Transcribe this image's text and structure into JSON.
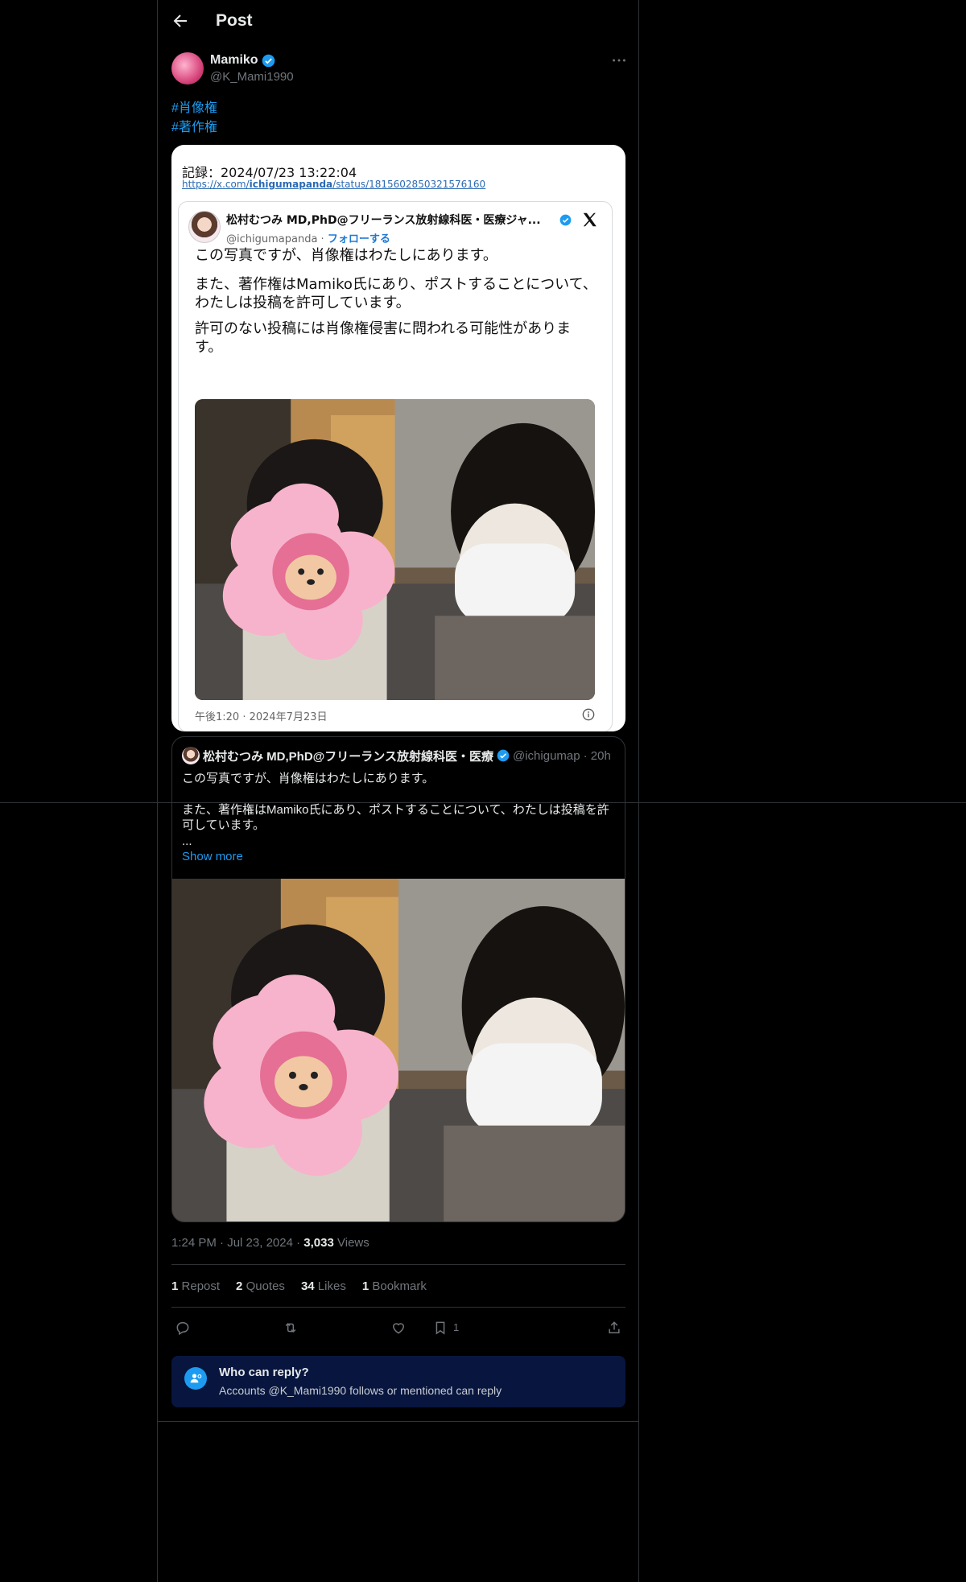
{
  "header": {
    "title": "Post"
  },
  "author": {
    "name": "Mamiko",
    "handle": "@K_Mami1990"
  },
  "hashtags": [
    "#肖像権",
    "#著作権"
  ],
  "screenshot": {
    "record_label": "記録：2024/07/23 13:22:04",
    "link_prefix": "https://x.com/",
    "link_user": "ichigumapanda",
    "link_suffix": "/status/1815602850321576160",
    "author_name": "松村むつみ MD,PhD@フリーランス放射線科医・医療ジャ...",
    "author_handle": "@ichigumapanda",
    "handle_sep": " · ",
    "follow_label": "フォローする",
    "paragraphs": [
      "この写真ですが、肖像権はわたしにあります。",
      "また、著作権はMamiko氏にあり、ポストすることについて、わたしは投稿を許可しています。",
      "許可のない投稿には肖像権侵害に問われる可能性があります。"
    ],
    "timestamp": "午後1:20 · 2024年7月23日"
  },
  "quote": {
    "author_name": "松村むつみ MD,PhD@フリーランス放射線科医・医療",
    "author_handle": "@ichigumap",
    "age": "· 20h",
    "paragraph_1": "この写真ですが、肖像権はわたしにあります。",
    "paragraph_2": "また、著作権はMamiko氏にあり、ポストすることについて、わたしは投稿を許可しています。",
    "ellipsis": "...",
    "show_more": "Show more"
  },
  "meta": {
    "time": "1:24 PM",
    "date": "Jul 23, 2024",
    "dot": "·",
    "views_count": "3,033",
    "views_label": "Views"
  },
  "stats": [
    {
      "count": "1",
      "label": "Repost"
    },
    {
      "count": "2",
      "label": "Quotes"
    },
    {
      "count": "34",
      "label": "Likes"
    },
    {
      "count": "1",
      "label": "Bookmark"
    }
  ],
  "actions": {
    "bookmark_count": "1",
    "icons": [
      "reply-icon",
      "repost-icon",
      "like-icon",
      "bookmark-icon",
      "share-icon"
    ]
  },
  "who_can_reply": {
    "title": "Who can reply?",
    "subtitle": "Accounts @K_Mami1990 follows or mentioned can reply"
  },
  "colors": {
    "accent": "#1d9bf0",
    "background": "#000000",
    "muted": "#71767b",
    "banner": "#08163f"
  }
}
